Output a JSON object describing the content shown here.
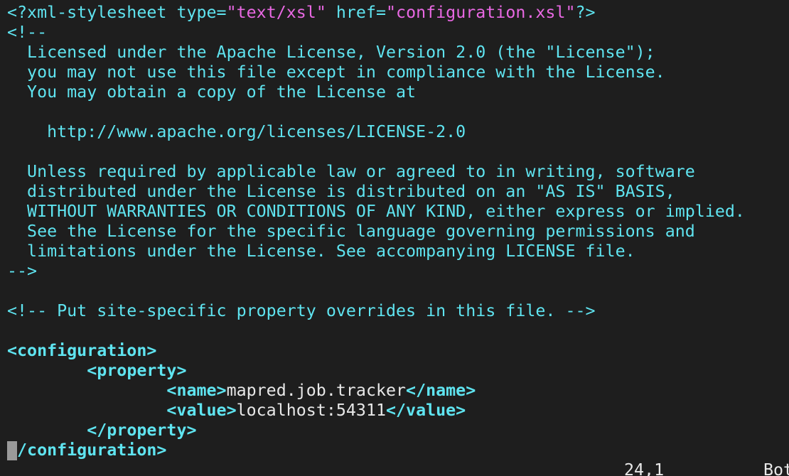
{
  "editor": {
    "lines": [
      {
        "segments": [
          {
            "t": "<?xml-stylesheet ",
            "c": "cyan"
          },
          {
            "t": "type=",
            "c": "cyan"
          },
          {
            "t": "\"text/xsl\"",
            "c": "mag"
          },
          {
            "t": " href=",
            "c": "cyan"
          },
          {
            "t": "\"configuration.xsl\"",
            "c": "mag"
          },
          {
            "t": "?>",
            "c": "cyan"
          }
        ]
      },
      {
        "segments": [
          {
            "t": "<!--",
            "c": "cyan"
          }
        ]
      },
      {
        "segments": [
          {
            "t": "  Licensed under the Apache License, Version 2.0 (the \"License\");",
            "c": "cyan"
          }
        ]
      },
      {
        "segments": [
          {
            "t": "  you may not use this file except in compliance with the License.",
            "c": "cyan"
          }
        ]
      },
      {
        "segments": [
          {
            "t": "  You may obtain a copy of the License at",
            "c": "cyan"
          }
        ]
      },
      {
        "segments": [
          {
            "t": "",
            "c": "cyan"
          }
        ]
      },
      {
        "segments": [
          {
            "t": "    http://www.apache.org/licenses/LICENSE-2.0",
            "c": "cyan"
          }
        ]
      },
      {
        "segments": [
          {
            "t": "",
            "c": "cyan"
          }
        ]
      },
      {
        "segments": [
          {
            "t": "  Unless required by applicable law or agreed to in writing, software",
            "c": "cyan"
          }
        ]
      },
      {
        "segments": [
          {
            "t": "  distributed under the License is distributed on an \"AS IS\" BASIS,",
            "c": "cyan"
          }
        ]
      },
      {
        "segments": [
          {
            "t": "  WITHOUT WARRANTIES OR CONDITIONS OF ANY KIND, either express or implied.",
            "c": "cyan"
          }
        ]
      },
      {
        "segments": [
          {
            "t": "  See the License for the specific language governing permissions and",
            "c": "cyan"
          }
        ]
      },
      {
        "segments": [
          {
            "t": "  limitations under the License. See accompanying LICENSE file.",
            "c": "cyan"
          }
        ]
      },
      {
        "segments": [
          {
            "t": "-->",
            "c": "cyan"
          }
        ]
      },
      {
        "segments": [
          {
            "t": "",
            "c": "cyan"
          }
        ]
      },
      {
        "segments": [
          {
            "t": "<!-- Put site-specific property overrides in this file. -->",
            "c": "cyan"
          }
        ]
      },
      {
        "segments": [
          {
            "t": "",
            "c": "cyan"
          }
        ]
      },
      {
        "segments": [
          {
            "t": "<configuration>",
            "c": "cyanb"
          }
        ]
      },
      {
        "segments": [
          {
            "t": "        ",
            "c": "white"
          },
          {
            "t": "<property>",
            "c": "cyanb"
          }
        ]
      },
      {
        "segments": [
          {
            "t": "                ",
            "c": "white"
          },
          {
            "t": "<name>",
            "c": "cyanb"
          },
          {
            "t": "mapred.job.tracker",
            "c": "white"
          },
          {
            "t": "</name>",
            "c": "cyanb"
          }
        ]
      },
      {
        "segments": [
          {
            "t": "                ",
            "c": "white"
          },
          {
            "t": "<value>",
            "c": "cyanb"
          },
          {
            "t": "localhost:54311",
            "c": "white"
          },
          {
            "t": "</value>",
            "c": "cyanb"
          }
        ]
      },
      {
        "segments": [
          {
            "t": "        ",
            "c": "white"
          },
          {
            "t": "</property>",
            "c": "cyanb"
          }
        ]
      },
      {
        "segments": [
          {
            "t": "</configuration>",
            "c": "cyanb"
          }
        ]
      }
    ]
  },
  "status_bar": {
    "position": "24,1",
    "scroll": "Bot"
  }
}
